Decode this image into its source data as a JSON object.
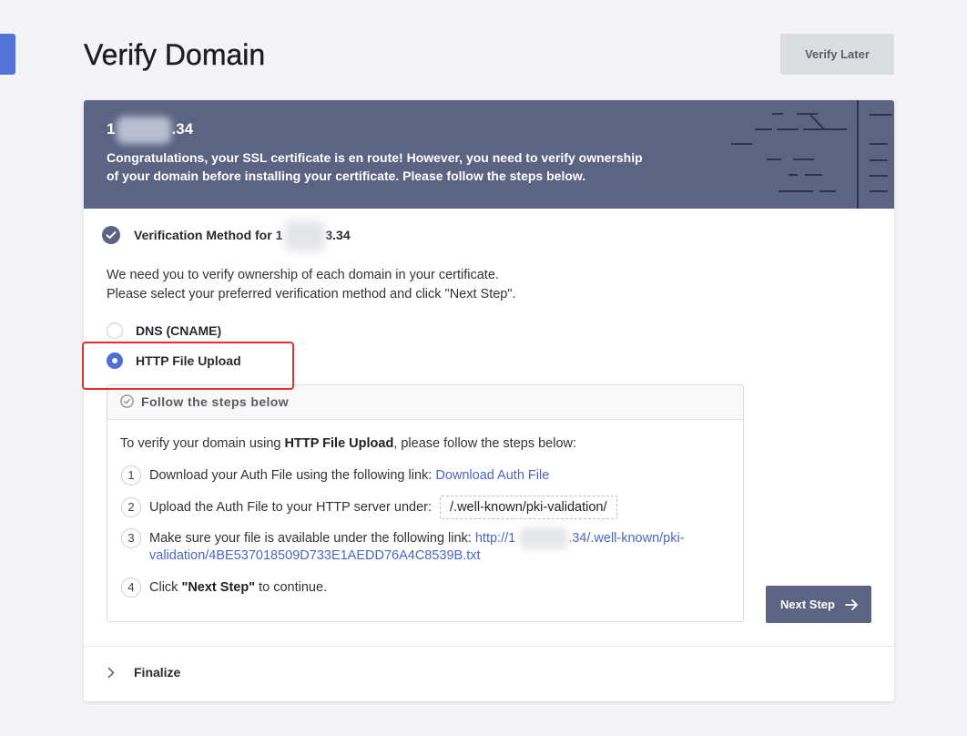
{
  "colors": {
    "accent": "#4f6fd6",
    "banner": "#5b6482",
    "highlight": "#e53030",
    "link": "#4a67c8",
    "side_tab": "#5274d9"
  },
  "page": {
    "title": "Verify Domain",
    "verify_later_label": "Verify Later"
  },
  "banner": {
    "domain_prefix": "1",
    "domain_suffix": ".34",
    "message": "Congratulations, your SSL certificate is en route! However, you need to verify ownership of your domain before installing your certificate. Please follow the steps below."
  },
  "method_section": {
    "icon": "check-circle-icon",
    "title_prefix": "Verification Method for ",
    "domain_prefix": "1",
    "domain_suffix": "3.34",
    "description_line1": "We need you to verify ownership of each domain in your certificate.",
    "description_line2": "Please select your preferred verification method and click \"Next Step\".",
    "options": [
      {
        "label": "DNS (CNAME)",
        "selected": false
      },
      {
        "label": "HTTP File Upload",
        "selected": true
      }
    ]
  },
  "steps_panel": {
    "icon": "circle-check-outline-icon",
    "header": "Follow the steps below",
    "intro_prefix": "To verify your domain using ",
    "intro_method": "HTTP File Upload",
    "intro_suffix": ", please follow the steps below:",
    "steps": [
      {
        "number": "1",
        "text": "Download your Auth File using the following link: ",
        "link": "Download Auth File"
      },
      {
        "number": "2",
        "text": "Upload the Auth File to your HTTP server under:",
        "path": "/.well-known/pki-validation/"
      },
      {
        "number": "3",
        "text": "Make sure your file is available under the following link: ",
        "link_prefix": "http://1",
        "link_suffix": ".34/.well-known/pki-validation/4BE537018509D733E1AEDD76A4C8539B.txt"
      },
      {
        "number": "4",
        "text_prefix": "Click ",
        "emphasis": "\"Next Step\"",
        "text_suffix": " to continue."
      }
    ]
  },
  "next_button": {
    "label": "Next Step",
    "icon": "arrow-right-icon"
  },
  "finalize": {
    "label": "Finalize",
    "icon": "chevron-right-icon"
  }
}
